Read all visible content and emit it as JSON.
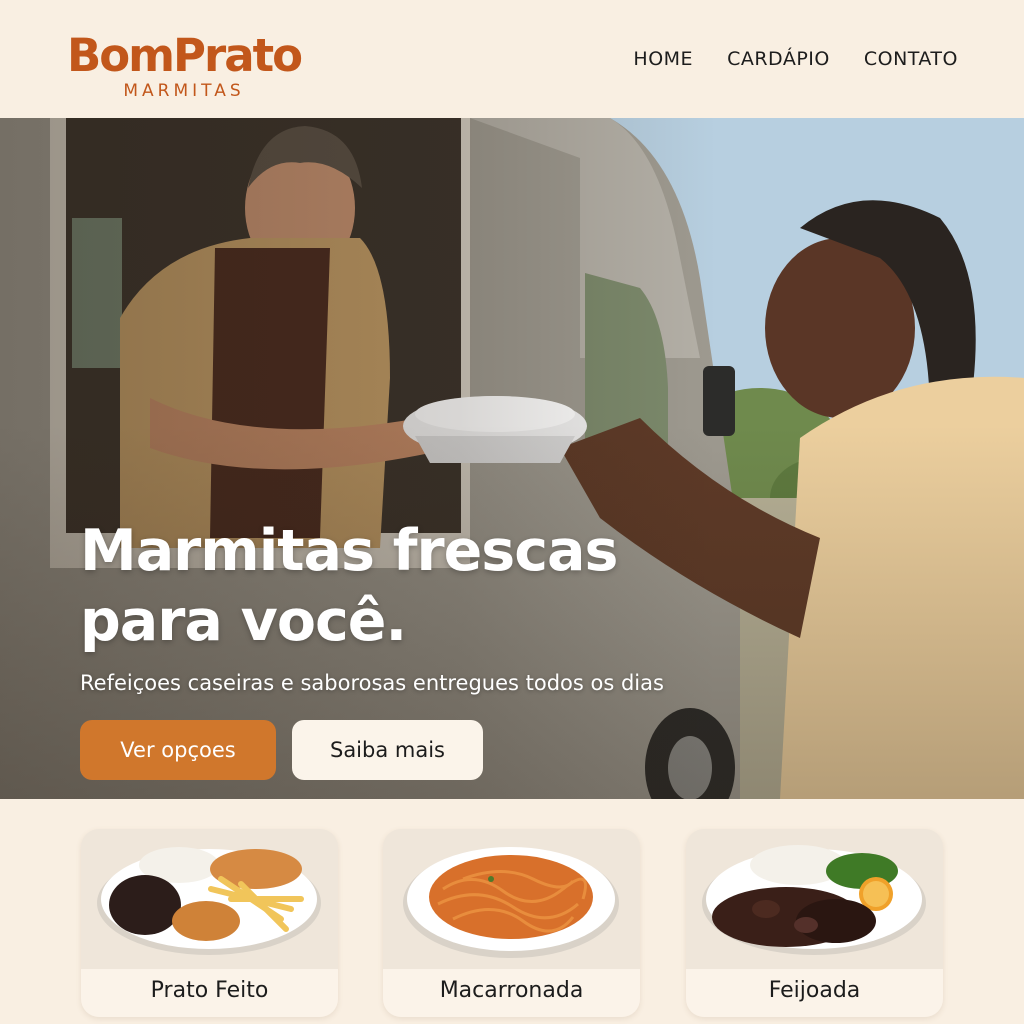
{
  "brand": {
    "name": "BomPrato",
    "tagline": "MARMITAS",
    "color": "#c2571b"
  },
  "nav": {
    "items": [
      "HOME",
      "CARDÁPIO",
      "CONTATO"
    ]
  },
  "hero": {
    "title_line1": "Marmitas frescas",
    "title_line2": "para você.",
    "subtitle": "Refeiçoes caseiras e saborosas entregues todos os dias",
    "primary_button": "Ver opçoes",
    "secondary_button": "Saiba mais",
    "accent": "#d0772c"
  },
  "menu_cards": [
    {
      "label": "Prato Feito"
    },
    {
      "label": "Macarronada"
    },
    {
      "label": "Feijoada"
    }
  ]
}
